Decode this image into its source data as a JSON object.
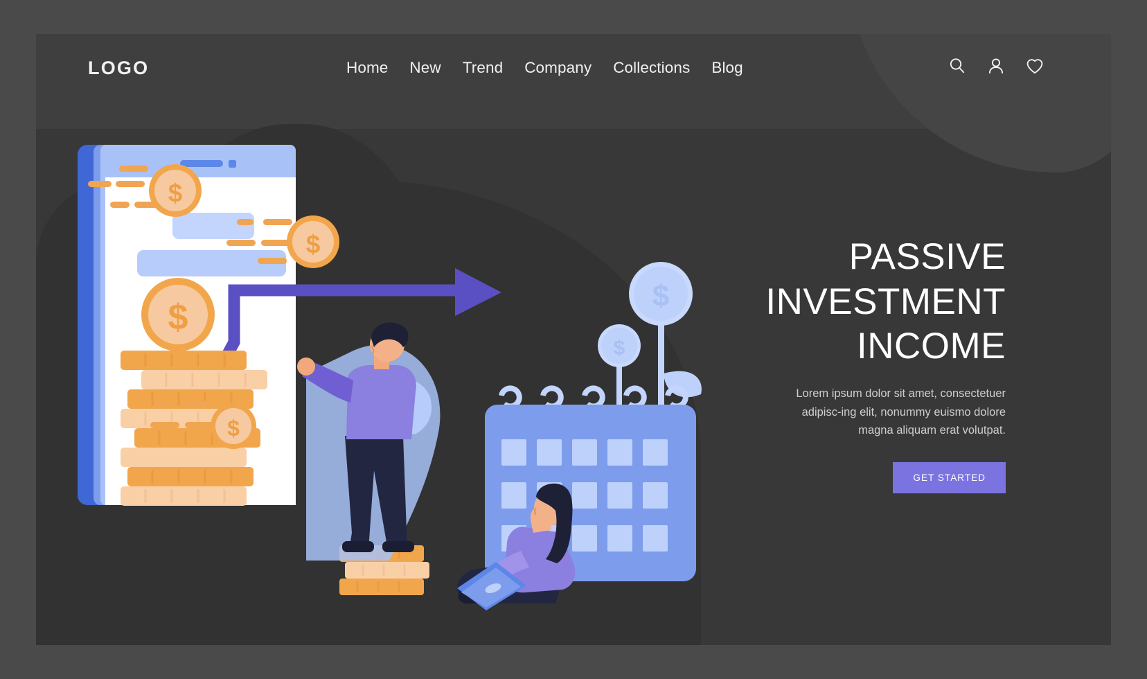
{
  "brand": {
    "logo": "LOGO"
  },
  "nav": {
    "links": [
      {
        "label": "Home"
      },
      {
        "label": "New"
      },
      {
        "label": "Trend"
      },
      {
        "label": "Company"
      },
      {
        "label": "Collections"
      },
      {
        "label": "Blog"
      }
    ],
    "icons": [
      {
        "name": "search-icon"
      },
      {
        "name": "user-icon"
      },
      {
        "name": "heart-icon"
      }
    ]
  },
  "hero": {
    "title": "PASSIVE\nINVESTMENT\nINCOME",
    "subtitle": "Lorem ipsum dolor sit amet, consectetuer adipisc-ing elit, nonummy euismo dolore magna aliquam erat volutpat.",
    "cta_label": "GET STARTED"
  },
  "illustration": {
    "name": "passive-investment-income-illustration",
    "coin_symbol": "$",
    "elements": [
      "smartphone-chart",
      "growth-arrow",
      "coin-stacks",
      "flying-coins",
      "money-plant",
      "calendar",
      "standing-man",
      "sitting-woman-with-laptop"
    ]
  },
  "colors": {
    "page_background": "#383838",
    "outer_background": "#4a4a4a",
    "accent_purple": "#7b74e0",
    "coin_orange": "#f2a64c",
    "coin_light": "#f7c9a0",
    "blue_light": "#bed1fb",
    "blue_mid": "#7d9cec",
    "blue_dark": "#4a72d8",
    "heading_white": "#ffffff",
    "body_grey": "#cfcfcf"
  }
}
